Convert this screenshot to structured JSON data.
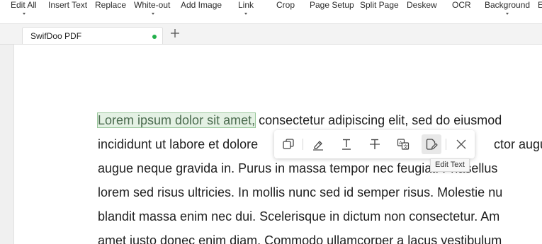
{
  "ribbon": {
    "items": [
      {
        "label": "Edit All",
        "has_dropdown": true
      },
      {
        "label": "Insert Text",
        "has_dropdown": false
      },
      {
        "label": "Replace",
        "has_dropdown": false
      },
      {
        "label": "White-out",
        "has_dropdown": true
      },
      {
        "label": "Add Image",
        "has_dropdown": false
      },
      {
        "label": "Link",
        "has_dropdown": true
      },
      {
        "label": "Crop",
        "has_dropdown": false
      },
      {
        "label": "Page Setup",
        "has_dropdown": false
      },
      {
        "label": "Split Page",
        "has_dropdown": false
      },
      {
        "label": "Deskew",
        "has_dropdown": false
      },
      {
        "label": "OCR",
        "has_dropdown": false
      },
      {
        "label": "Background",
        "has_dropdown": true
      },
      {
        "label": "E",
        "has_dropdown": false
      }
    ]
  },
  "tabs": [
    {
      "title": "SwifDoo PDF",
      "unsaved_indicator_color": "#22b04b"
    }
  ],
  "document": {
    "highlighted_text": "Lorem ipsum dolor sit amet,",
    "lines": [
      " consectetur adipiscing elit, sed do eiusmod",
      "incididunt ut labore et dolore",
      "augue neque gravida in. Purus in massa tempor nec feugiat. Phasellus",
      "lorem sed risus ultricies. In mollis nunc sed id semper risus. Molestie nu",
      "blandit massa enim nec dui. Scelerisque in dictum non consectetur. Am",
      "amet justo donec enim diam. Commodo ullamcorper a lacus vestibulum"
    ],
    "line2_tail": "ctor augue"
  },
  "floating_toolbar": {
    "buttons": [
      {
        "icon": "copy-icon",
        "tooltip": ""
      },
      {
        "icon": "highlight-icon",
        "tooltip": ""
      },
      {
        "icon": "underline-icon",
        "tooltip": ""
      },
      {
        "icon": "strikethrough-icon",
        "tooltip": ""
      },
      {
        "icon": "translate-icon",
        "tooltip": ""
      },
      {
        "icon": "edit-text-icon",
        "tooltip": "Edit Text"
      },
      {
        "icon": "close-icon",
        "tooltip": ""
      }
    ],
    "active_tooltip": "Edit Text"
  },
  "colors": {
    "highlight_bg": "#e4f1e4",
    "highlight_border": "#98c69a",
    "highlight_text": "#4b6b4f",
    "tab_dot": "#22b04b"
  }
}
